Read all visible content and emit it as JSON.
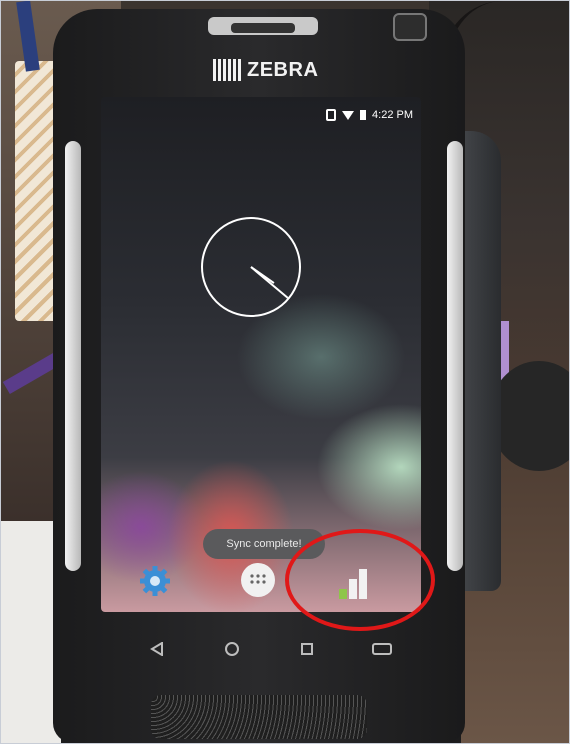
{
  "device": {
    "brand_logo_text": "ZEBRA"
  },
  "status_bar": {
    "time": "4:22 PM",
    "icons": [
      "vibrate-icon",
      "wifi-icon",
      "battery-icon"
    ]
  },
  "home_screen": {
    "clock_widget": "analog-clock",
    "toast_message": "Sync complete!",
    "dock": [
      {
        "name": "settings-icon",
        "color": "#3b8fd6"
      },
      {
        "name": "app-drawer-icon",
        "color": "#f1f1f1"
      },
      {
        "name": "signal-strength-app-icon",
        "color": "#7fbf3f"
      }
    ]
  },
  "navigation_bar": {
    "buttons": [
      "back-icon",
      "home-icon",
      "recents-icon"
    ]
  },
  "annotation": {
    "highlight_color": "#e01818",
    "highlighted": "signal-strength-app-icon"
  }
}
